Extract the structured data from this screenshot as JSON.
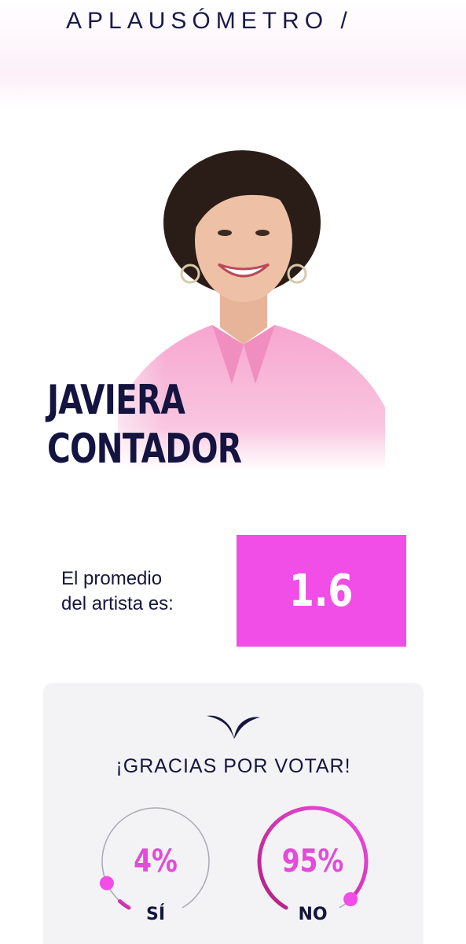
{
  "header": {
    "title": "APLAUSÓMETRO /"
  },
  "artist": {
    "name_line1": "JAVIERA",
    "name_line2": "CONTADOR",
    "photo_icon": "artist-portrait"
  },
  "average": {
    "label_line1": "El promedio",
    "label_line2": "del artista es:",
    "value": "1.6"
  },
  "vote": {
    "icon": "bird-logo-icon",
    "thanks": "¡GRACIAS POR VOTAR!",
    "options": [
      {
        "label": "SÍ",
        "percent_text": "4%",
        "percent": 4
      },
      {
        "label": "NO",
        "percent_text": "95%",
        "percent": 95
      }
    ]
  },
  "colors": {
    "accent": "#f04ee6",
    "text_dark": "#16153d",
    "card_bg": "#f3f3f6"
  }
}
